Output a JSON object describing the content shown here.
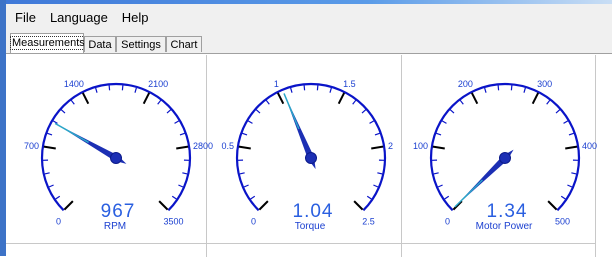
{
  "menu": [
    "File",
    "Language",
    "Help"
  ],
  "tabs": [
    "Measurements",
    "Data",
    "Settings",
    "Chart"
  ],
  "active_tab": "Measurements",
  "colors": {
    "gauge": "#0a14c8",
    "needle": "#1c2fb4",
    "needle_tip": "#2aa6c8",
    "readout": "#2a5fe0",
    "label": "#1c40d0"
  },
  "gauges": [
    {
      "label": "RPM",
      "readout": "967",
      "value": 967,
      "min": 0,
      "max": 3500,
      "tick_labels": [
        "0",
        "700",
        "1400",
        "2100",
        "2800",
        "3500"
      ]
    },
    {
      "label": "Torque",
      "readout": "1.04",
      "value": 1.04,
      "min": 0,
      "max": 2.5,
      "tick_labels": [
        "0",
        "0.5",
        "1",
        "1.5",
        "2",
        "2.5"
      ]
    },
    {
      "label": "Motor Power",
      "readout": "1.34",
      "value": 1.34,
      "min": 0,
      "max": 500,
      "tick_labels": [
        "0",
        "100",
        "200",
        "300",
        "400",
        "500"
      ]
    }
  ]
}
